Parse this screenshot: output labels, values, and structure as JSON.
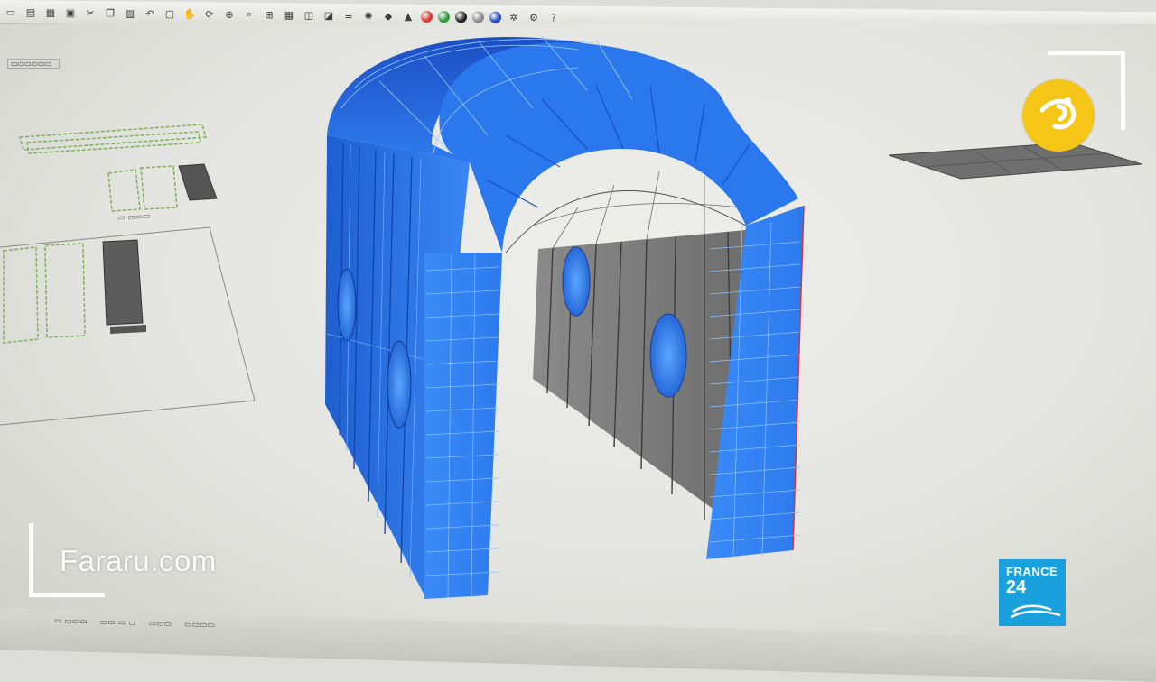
{
  "toolbar": {
    "buttons": [
      {
        "name": "new-file",
        "glyph": "▭"
      },
      {
        "name": "open",
        "glyph": "▤"
      },
      {
        "name": "save",
        "glyph": "▦"
      },
      {
        "name": "print",
        "glyph": "▣"
      },
      {
        "name": "cut",
        "glyph": "✂"
      },
      {
        "name": "copy",
        "glyph": "❐"
      },
      {
        "name": "paste",
        "glyph": "▨"
      },
      {
        "name": "undo",
        "glyph": "↶"
      },
      {
        "name": "select",
        "glyph": "▢"
      },
      {
        "name": "pan",
        "glyph": "✋"
      },
      {
        "name": "rotate",
        "glyph": "⟳"
      },
      {
        "name": "zoom",
        "glyph": "⊕"
      },
      {
        "name": "zoom-window",
        "glyph": "⌕"
      },
      {
        "name": "zoom-extents",
        "glyph": "⊞"
      },
      {
        "name": "grid",
        "glyph": "▦"
      },
      {
        "name": "wireframe",
        "glyph": "◫"
      },
      {
        "name": "ghosted",
        "glyph": "◪"
      },
      {
        "name": "layer",
        "glyph": "≡"
      },
      {
        "name": "light",
        "glyph": "✺"
      },
      {
        "name": "material",
        "glyph": "◆"
      },
      {
        "name": "lock",
        "glyph": "▲"
      },
      {
        "name": "render-red",
        "glyph": "",
        "color": "#d43a2e"
      },
      {
        "name": "render-green",
        "glyph": "",
        "color": "#2e9a3c"
      },
      {
        "name": "render-black",
        "glyph": "",
        "color": "#222222"
      },
      {
        "name": "render-gray",
        "glyph": "",
        "color": "#8a8a8a"
      },
      {
        "name": "render-blue",
        "glyph": "",
        "color": "#2647c2"
      },
      {
        "name": "settings",
        "glyph": "✲"
      },
      {
        "name": "options",
        "glyph": "⚙"
      },
      {
        "name": "help",
        "glyph": "?"
      }
    ]
  },
  "watermark": {
    "text": "Fararu.com"
  },
  "broadcaster": {
    "line1": "FRANCE",
    "line2": "24"
  },
  "colors": {
    "model_blue": "#2e7bf2",
    "panel_gray": "#7c7c7c",
    "viewport_bg": "#e6e6e2",
    "accent_yellow": "#f5c518",
    "france24_blue": "#1aa0dc"
  }
}
